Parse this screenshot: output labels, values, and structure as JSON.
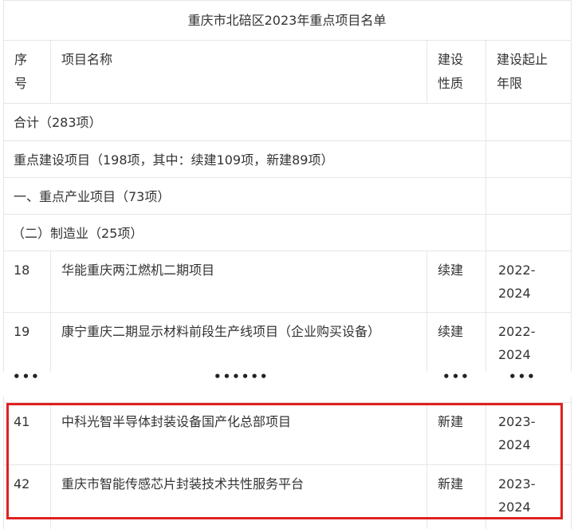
{
  "table": {
    "title": "重庆市北碚区2023年重点项目名单",
    "headers": {
      "index_line1": "序",
      "index_line2": "号",
      "name": "项目名称",
      "type_line1": "建设",
      "type_line2": "性质",
      "period_line1": "建设起止",
      "period_line2": "年限"
    },
    "sections": {
      "total": "合计（283项）",
      "key_construction": "重点建设项目（198项，其中：续建109项，新建89项）",
      "industry": "一、重点产业项目（73项）",
      "manufacturing": "（二）制造业（25项）"
    },
    "rows": [
      {
        "index": "18",
        "name": "华能重庆两江燃机二期项目",
        "type": "续建",
        "period_start": "2022-",
        "period_end": "2024"
      },
      {
        "index": "19",
        "name": "康宁重庆二期显示材料前段生产线项目（企业购买设备）",
        "type": "续建",
        "period_start": "2022-",
        "period_end": "2024"
      },
      {
        "index": "41",
        "name": "中科光智半导体封装设备国产化总部项目",
        "type": "新建",
        "period_start": "2023-",
        "period_end": "2024"
      },
      {
        "index": "42",
        "name": "重庆市智能传感芯片封装技术共性服务平台",
        "type": "新建",
        "period_start": "2023-",
        "period_end": "2024"
      }
    ],
    "ellipsis": {
      "index": "•••",
      "name": "••••••",
      "type": "•••",
      "period": "•••"
    }
  }
}
